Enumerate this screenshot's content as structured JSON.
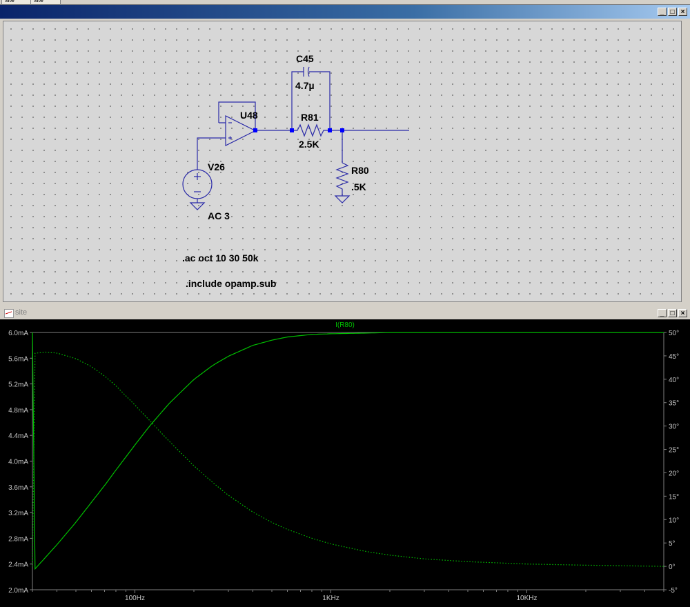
{
  "tabs": [
    "site",
    "site"
  ],
  "top_window": {
    "title": "",
    "buttons": [
      "_",
      "□",
      "×"
    ]
  },
  "schematic": {
    "components": {
      "opamp": "U48",
      "cap_name": "C45",
      "cap_value": "4.7µ",
      "r_series_name": "R81",
      "r_series_value": "2.5K",
      "r_shunt_name": "R80",
      "r_shunt_value": ".5K",
      "source_name": "V26",
      "source_value": "AC 3"
    },
    "directives": [
      ".ac oct 10 30 50k",
      ".include opamp.sub"
    ],
    "colors": {
      "wire": "#2a2aa8",
      "node": "#0000ff",
      "background": "#d7d7d7",
      "grid_dot": "#6a6a6a"
    }
  },
  "plot_window": {
    "title": "site",
    "buttons": [
      "_",
      "□",
      "×"
    ],
    "trace_label": "I(R80)",
    "colors": {
      "trace": "#00c000",
      "background": "#000000",
      "axis": "#808080",
      "text": "#c8c8c8"
    }
  },
  "chart_data": {
    "type": "line",
    "title": "I(R80)",
    "xscale": "log",
    "xlim": [
      30,
      50000
    ],
    "x_ticks": [
      "100Hz",
      "1KHz",
      "10KHz"
    ],
    "x_tick_values": [
      100,
      1000,
      10000
    ],
    "y_left_ticks": [
      "6.0mA",
      "5.6mA",
      "5.2mA",
      "4.8mA",
      "4.4mA",
      "4.0mA",
      "3.6mA",
      "3.2mA",
      "2.8mA",
      "2.4mA",
      "2.0mA"
    ],
    "y_left_values": [
      6.0,
      5.6,
      5.2,
      4.8,
      4.4,
      4.0,
      3.6,
      3.2,
      2.8,
      2.4,
      2.0
    ],
    "ylim_left": [
      2.0,
      6.0
    ],
    "y_right_ticks": [
      "50°",
      "45°",
      "40°",
      "35°",
      "30°",
      "25°",
      "20°",
      "15°",
      "10°",
      "5°",
      "0°",
      "-5°"
    ],
    "y_right_values": [
      50,
      45,
      40,
      35,
      30,
      25,
      20,
      15,
      10,
      5,
      0,
      -5
    ],
    "ylim_right": [
      -5,
      50
    ],
    "series": [
      {
        "name": "I(R80)",
        "axis": "left",
        "style": "solid",
        "x": [
          30,
          40,
          50,
          60,
          70,
          80,
          100,
          120,
          150,
          200,
          250,
          300,
          400,
          500,
          600,
          800,
          1000,
          1500,
          2000,
          5000,
          10000,
          50000
        ],
        "y": [
          2.28,
          2.7,
          3.05,
          3.36,
          3.62,
          3.86,
          4.25,
          4.56,
          4.9,
          5.27,
          5.49,
          5.63,
          5.8,
          5.88,
          5.93,
          5.97,
          5.98,
          5.99,
          6.0,
          6.0,
          6.0,
          6.0
        ]
      },
      {
        "name": "",
        "axis": "right",
        "style": "dotted",
        "x": [
          30,
          35,
          40,
          50,
          60,
          70,
          80,
          100,
          120,
          150,
          200,
          250,
          300,
          400,
          500,
          600,
          800,
          1000,
          1500,
          2000,
          3000,
          5000,
          10000,
          20000,
          50000
        ],
        "y": [
          45.5,
          45.8,
          45.6,
          44.4,
          42.7,
          40.7,
          38.6,
          34.5,
          31.0,
          26.7,
          21.5,
          17.9,
          15.2,
          11.6,
          9.4,
          7.9,
          6.0,
          4.8,
          3.2,
          2.4,
          1.6,
          1.0,
          0.5,
          0.25,
          0.0
        ]
      }
    ]
  }
}
